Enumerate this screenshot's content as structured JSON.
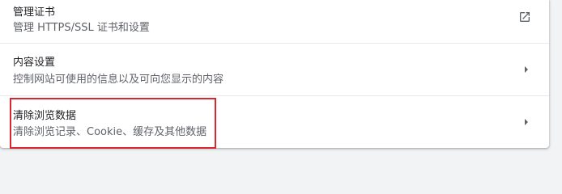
{
  "rows": [
    {
      "title": "管理证书",
      "subtitle": "管理 HTTPS/SSL 证书和设置",
      "icon": "open-in-new-icon"
    },
    {
      "title": "内容设置",
      "subtitle": "控制网站可使用的信息以及可向您显示的内容",
      "icon": "arrow-right-icon"
    },
    {
      "title": "清除浏览数据",
      "subtitle": "清除浏览记录、Cookie、缓存及其他数据",
      "icon": "arrow-right-icon"
    }
  ],
  "colors": {
    "title": "#202124",
    "subtitle": "#5f6368",
    "icon": "#5f6368",
    "highlight": "#d9272e",
    "background": "#f1f3f4"
  }
}
